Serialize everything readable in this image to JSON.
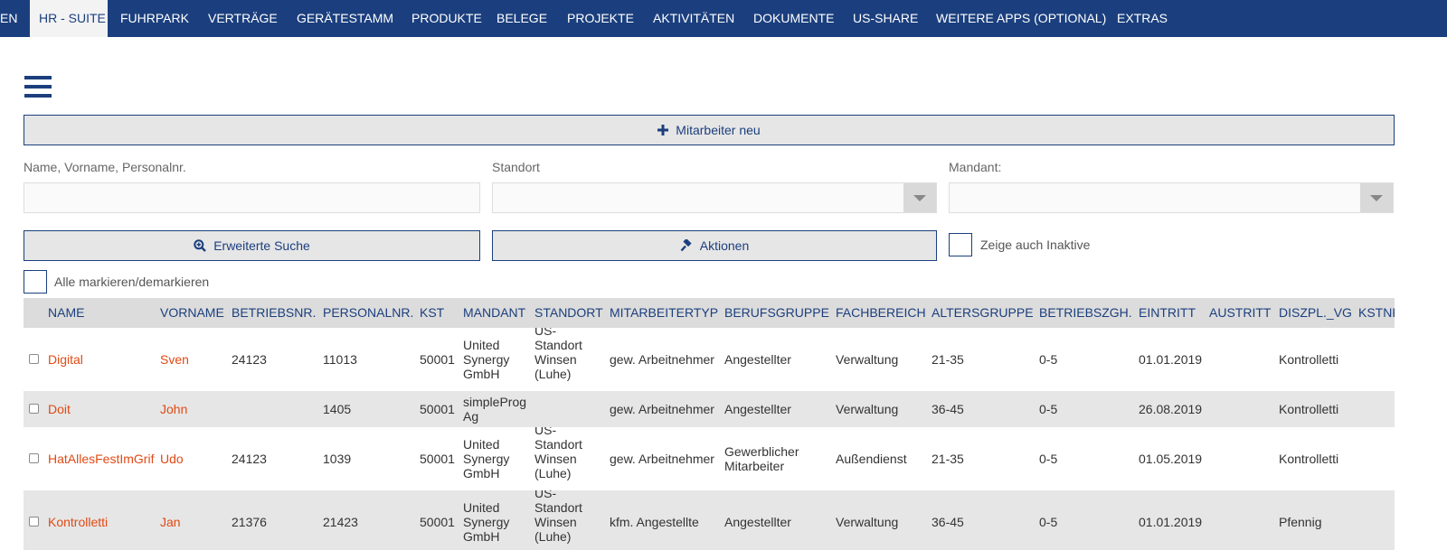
{
  "nav": {
    "items": [
      "EN",
      "HR - SUITE",
      "FUHRPARK",
      "VERTRÄGE",
      "GERÄTESTAMM",
      "PRODUKTE",
      "BELEGE",
      "PROJEKTE",
      "AKTIVITÄTEN",
      "DOKUMENTE",
      "US-SHARE",
      "WEITERE APPS (OPTIONAL)",
      "EXTRAS"
    ],
    "active": "HR - SUITE"
  },
  "toolbar": {
    "new_button": "Mitarbeiter neu",
    "extended_search": "Erweiterte Suche",
    "actions": "Aktionen"
  },
  "filters": {
    "name_label": "Name, Vorname, Personalnr.",
    "name_value": "",
    "location_label": "Standort",
    "location_value": "",
    "client_label": "Mandant:",
    "client_value": ""
  },
  "options": {
    "show_inactive": "Zeige auch Inaktive",
    "select_all": "Alle markieren/demarkieren"
  },
  "table": {
    "columns": [
      "NAME",
      "VORNAME",
      "BETRIEBSNR.",
      "PERSONALNR.",
      "KST",
      "MANDANT",
      "STANDORT",
      "MITARBEITERTYP",
      "BERUFSGRUPPE",
      "FACHBEREICH",
      "ALTERSGRUPPE",
      "BETRIEBSZGH.",
      "EINTRITT",
      "AUSTRITT",
      "DISZPL._VG",
      "KSTNR"
    ],
    "rows": [
      [
        "Digital",
        "Sven",
        "24123",
        "11013",
        "50001",
        "United Synergy GmbH",
        "US-Standort Winsen (Luhe)",
        "gew. Arbeitnehmer",
        "Angestellter",
        "Verwaltung",
        "21-35",
        "0-5",
        "01.01.2019",
        "",
        "Kontrolletti"
      ],
      [
        "Doit",
        "John",
        "",
        "1405",
        "50001",
        "simpleProg Ag",
        "",
        "gew. Arbeitnehmer",
        "Angestellter",
        "Verwaltung",
        "36-45",
        "0-5",
        "26.08.2019",
        "",
        "Kontrolletti"
      ],
      [
        "HatAllesFestImGrif",
        "Udo",
        "24123",
        "1039",
        "50001",
        "United Synergy GmbH",
        "US-Standort Winsen (Luhe)",
        "gew. Arbeitnehmer",
        "Gewerblicher Mitarbeiter",
        "Außendienst",
        "21-35",
        "0-5",
        "01.05.2019",
        "",
        "Kontrolletti"
      ],
      [
        "Kontrolletti",
        "Jan",
        "21376",
        "21423",
        "50001",
        "United Synergy GmbH",
        "US-Standort Winsen (Luhe)",
        "kfm. Angestellte",
        "Angestellter",
        "Verwaltung",
        "36-45",
        "0-5",
        "01.01.2019",
        "",
        "Pfennig"
      ]
    ]
  },
  "colors": {
    "nav_bg": "#1b3f7e",
    "accent": "#1b3f7e",
    "link": "#e04a14",
    "header_bg": "#dcdcdc",
    "row_alt_bg": "#e6e6e6"
  }
}
